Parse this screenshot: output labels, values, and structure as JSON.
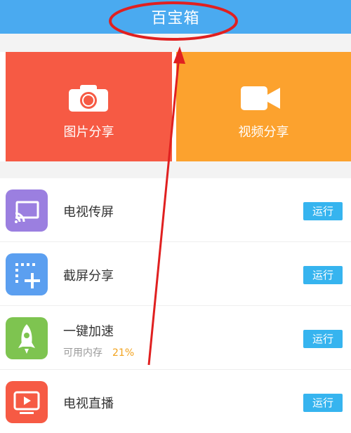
{
  "header": {
    "title": "百宝箱"
  },
  "tiles": [
    {
      "label": "图片分享",
      "icon": "camera-icon",
      "color": "#f65a44"
    },
    {
      "label": "视频分享",
      "icon": "video-camera-icon",
      "color": "#fca22e"
    }
  ],
  "tools": [
    {
      "name": "电视传屏",
      "button": "运行",
      "icon": "cast-icon",
      "color": "#9b7fe0"
    },
    {
      "name": "截屏分享",
      "button": "运行",
      "icon": "screenshot-add-icon",
      "color": "#5b9ff0"
    },
    {
      "name": "一键加速",
      "sub_label": "可用内存",
      "sub_value": "21%",
      "button": "运行",
      "icon": "rocket-icon",
      "color": "#7ec450"
    },
    {
      "name": "电视直播",
      "button": "运行",
      "icon": "tv-play-icon",
      "color": "#f65a44"
    }
  ],
  "annotation_color": "#e02020",
  "accent": "#4aaaf0"
}
